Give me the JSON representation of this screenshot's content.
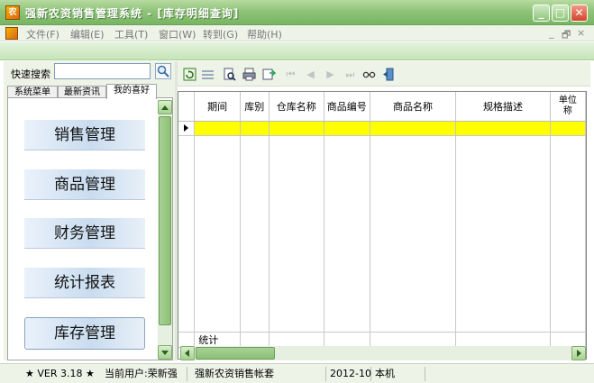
{
  "window": {
    "app_icon": "app-logo-icon",
    "title": "强新农资销售管理系统 - [库存明细查询]",
    "minimize_glyph": "_",
    "maximize_glyph": "□",
    "close_glyph": "✕"
  },
  "menu": {
    "items": [
      "文件(F)",
      "编辑(E)",
      "工具(T)",
      "窗口(W)",
      "转到(G)",
      "帮助(H)"
    ],
    "mdi_controls": [
      "_",
      "🗗",
      "×"
    ]
  },
  "sidebar": {
    "quick_search_label": "快速搜索",
    "quick_search_value": "",
    "tabs": [
      "系统菜单",
      "最新资讯",
      "我的喜好"
    ],
    "active_tab": 2,
    "modules": [
      "销售管理",
      "商品管理",
      "财务管理",
      "统计报表",
      "库存管理"
    ]
  },
  "toolbar": {
    "icons": [
      "refresh-icon",
      "list-icon",
      "preview-icon",
      "print-icon",
      "export-icon",
      "first-record-icon",
      "prev-record-icon",
      "next-record-icon",
      "last-record-icon",
      "glasses-icon",
      "exit-icon"
    ]
  },
  "grid": {
    "columns": [
      "期间",
      "库别",
      "仓库名称",
      "商品编号",
      "商品名称",
      "规格描述",
      "单位\n称"
    ],
    "total_label": "统计",
    "selected_row_color": "#ffff00"
  },
  "statusbar": {
    "version": "★ VER 3.18 ★",
    "current_user": "当前用户:荣新强",
    "account_set": "强新农资销售帐套",
    "period": "2012-10",
    "location": "本机"
  }
}
